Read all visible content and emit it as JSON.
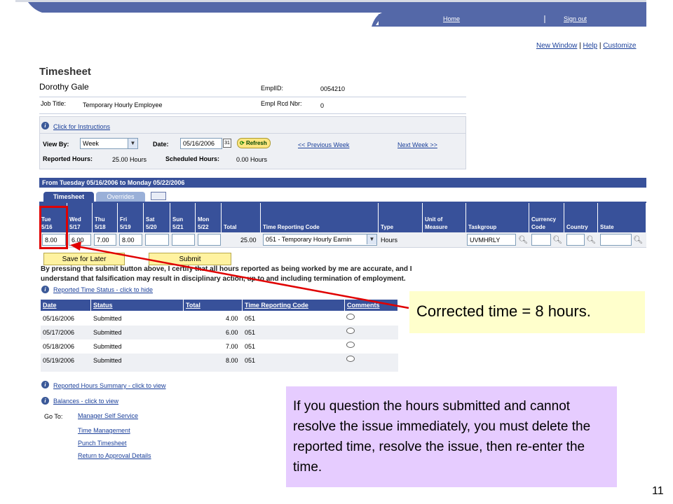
{
  "header": {
    "home_label": "Home",
    "signout_label": "Sign out",
    "links": [
      "New Window",
      "Help",
      "Customize"
    ]
  },
  "page": {
    "title": "Timesheet",
    "employee_name": "Dorothy Gale",
    "job_title_label": "Job Title:",
    "job_title": "Temporary Hourly Employee",
    "emplid_label": "EmplID:",
    "emplid": "0054210",
    "empl_rcd_label": "Empl Rcd Nbr:",
    "empl_rcd": "0"
  },
  "controls": {
    "instructions_link": "Click for Instructions",
    "view_by_label": "View By:",
    "view_by_value": "Week",
    "date_label": "Date:",
    "date_value": "05/16/2006",
    "calendar_label": "31",
    "refresh_label": "Refresh",
    "prev_week": "<< Previous Week",
    "next_week": "Next Week >>",
    "reported_hours_label": "Reported Hours:",
    "reported_hours": "25.00 Hours",
    "scheduled_hours_label": "Scheduled Hours:",
    "scheduled_hours": "0.00 Hours"
  },
  "period": {
    "title": "From Tuesday 05/16/2006 to Monday 05/22/2006",
    "tabs": [
      "Timesheet",
      "Overrides"
    ]
  },
  "grid": {
    "headers": [
      {
        "l1": "Tue",
        "l2": "5/16"
      },
      {
        "l1": "Wed",
        "l2": "5/17"
      },
      {
        "l1": "Thu",
        "l2": "5/18"
      },
      {
        "l1": "Fri",
        "l2": "5/19"
      },
      {
        "l1": "Sat",
        "l2": "5/20"
      },
      {
        "l1": "Sun",
        "l2": "5/21"
      },
      {
        "l1": "Mon",
        "l2": "5/22"
      },
      {
        "l1": "",
        "l2": "Total"
      },
      {
        "l1": "",
        "l2": "Time Reporting Code"
      },
      {
        "l1": "",
        "l2": "Type"
      },
      {
        "l1": "Unit of",
        "l2": "Measure"
      },
      {
        "l1": "",
        "l2": "Taskgroup"
      },
      {
        "l1": "Currency",
        "l2": "Code"
      },
      {
        "l1": "",
        "l2": "Country"
      },
      {
        "l1": "",
        "l2": "State"
      }
    ],
    "row": {
      "tue": "8.00",
      "wed": "6.00",
      "thu": "7.00",
      "fri": "8.00",
      "sat": "",
      "sun": "",
      "mon": "",
      "total": "25.00",
      "trc": "051 - Temporary Hourly Earnin",
      "type": "Hours",
      "taskgroup": "UVMHRLY"
    }
  },
  "buttons": {
    "save_later": "Save for Later",
    "submit": "Submit"
  },
  "warning": "By pressing the submit button above, I certify that all hours reported as being worked by me are accurate, and I understand that falsification may result in disciplinary action, up to and including termination of employment.",
  "reported_status": {
    "link": "Reported Time Status - click to hide",
    "headers": [
      "Date",
      "Status",
      "Total",
      "Time Reporting Code",
      "Comments"
    ],
    "rows": [
      {
        "date": "05/16/2006",
        "status": "Submitted",
        "total": "4.00",
        "trc": "051"
      },
      {
        "date": "05/17/2006",
        "status": "Submitted",
        "total": "6.00",
        "trc": "051"
      },
      {
        "date": "05/18/2006",
        "status": "Submitted",
        "total": "7.00",
        "trc": "051"
      },
      {
        "date": "05/19/2006",
        "status": "Submitted",
        "total": "8.00",
        "trc": "051"
      }
    ]
  },
  "bottom_links": {
    "summary": "Reported Hours Summary - click to view",
    "balances": "Balances - click to view",
    "goto_label": "Go To:",
    "goto": [
      "Manager Self Service",
      "Time Management",
      "Punch Timesheet",
      "Return to Approval Details"
    ]
  },
  "callouts": {
    "corrected": "Corrected time = 8 hours.",
    "note": "If you question the hours submitted and cannot resolve the issue immediately, you must delete the reported time, resolve the issue, then re-enter the time."
  },
  "slide_number": "11",
  "colors": {
    "header_blue": "#38519a",
    "callout_yellow": "#ffffcc",
    "callout_purple": "#e6ccff",
    "highlight_red": "#e00000"
  }
}
